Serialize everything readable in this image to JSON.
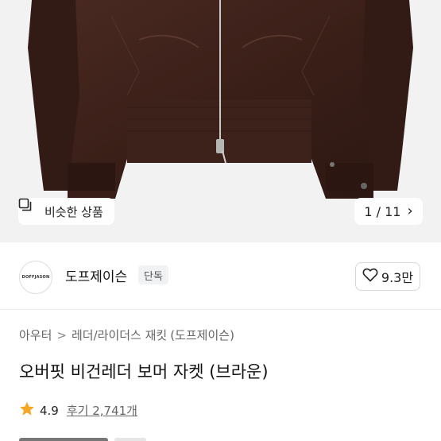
{
  "gallery": {
    "similar_label": "비슷한 상품",
    "pager_current": "1",
    "pager_total": "11",
    "pager_separator": "/",
    "jacket_color": "#3b2019"
  },
  "brand": {
    "logo_text": "DOFFJASON",
    "name": "도프제이슨",
    "badge": "단독",
    "likes": "9.3만"
  },
  "breadcrumb": {
    "items": [
      "아우터",
      "레더/라이더스 재킷",
      "(도프제이슨)"
    ],
    "separator": ">"
  },
  "product": {
    "title": "오버핏 비건레더 보머 자켓 (브라운)",
    "rating": "4.9",
    "reviews": "후기 2,741개",
    "star_color": "#f5a623"
  }
}
